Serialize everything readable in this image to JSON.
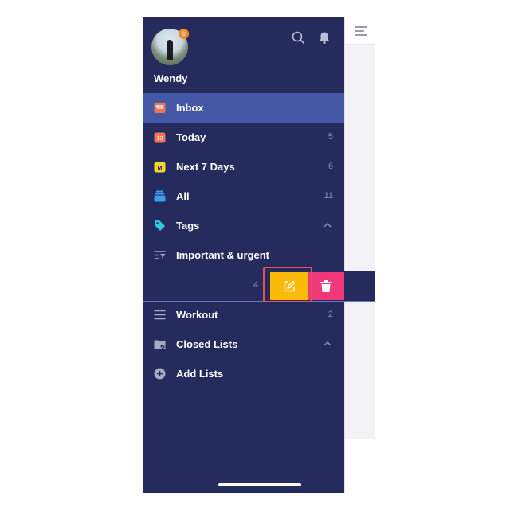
{
  "user": {
    "name": "Wendy"
  },
  "nav": {
    "inbox": {
      "label": "Inbox",
      "count": ""
    },
    "today": {
      "label": "Today",
      "count": "5",
      "icon_text": "10"
    },
    "next7": {
      "label": "Next 7 Days",
      "count": "6",
      "icon_text": "M"
    },
    "all": {
      "label": "All",
      "count": "11"
    },
    "tags": {
      "label": "Tags"
    },
    "important": {
      "label": "Important & urgent"
    },
    "swiped": {
      "count": "4"
    },
    "workout": {
      "label": "Workout",
      "count": "2"
    },
    "closed": {
      "label": "Closed Lists"
    },
    "add": {
      "label": "Add Lists"
    }
  },
  "colors": {
    "drawer_bg": "#252b5c",
    "active_bg": "#4458a6",
    "edit": "#f9ba09",
    "delete": "#f0377a",
    "highlight": "#e4515b"
  },
  "icons": {
    "header": [
      "search-icon",
      "bell-icon"
    ],
    "actions": [
      "edit-icon",
      "trash-icon"
    ]
  }
}
